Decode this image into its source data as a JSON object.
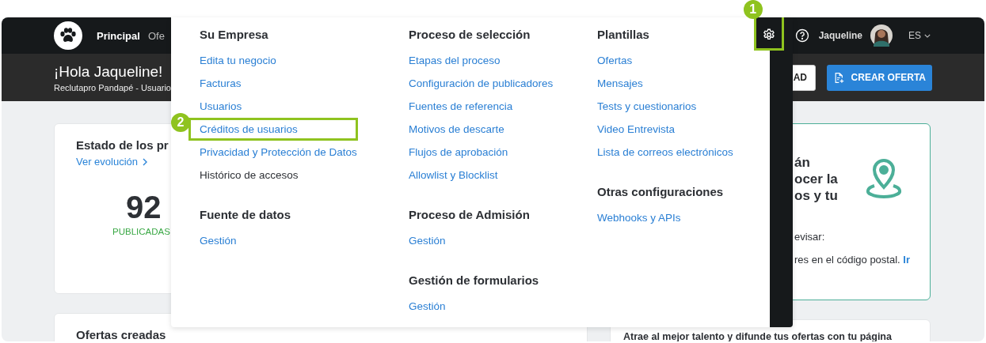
{
  "nav": {
    "items": [
      {
        "label": "Principal",
        "selected": true
      },
      {
        "label": "Ofe",
        "selected": false
      }
    ],
    "settings": {
      "highlighted": true,
      "callout": "1"
    },
    "user": "Jaqueline",
    "language": "ES"
  },
  "header": {
    "greeting": "¡Hola Jaqueline!",
    "subtitle": "Reclutapro Pandapé - Usuario",
    "buttons": [
      {
        "label": "AD",
        "kind": "outline"
      },
      {
        "label": "CREAR OFERTA",
        "kind": "primary"
      }
    ]
  },
  "status_card": {
    "title": "Estado de los pr",
    "link": "Ver evolución",
    "count": "92",
    "count_label": "PUBLICADAS"
  },
  "offers_card": {
    "title": "Ofertas creadas"
  },
  "location_card": {
    "heading_lines": [
      "án",
      "ocer la",
      "os y tu"
    ],
    "review_label": "evisar:",
    "note": "res en el código postal.",
    "note_link": "Ir"
  },
  "talent_card": {
    "text": "Atrae al mejor talento y difunde tus ofertas con tu página"
  },
  "settings_menu": {
    "columns": [
      {
        "sections": [
          {
            "title": "Su Empresa",
            "items": [
              {
                "label": "Edita tu negocio",
                "kind": "link",
                "highlighted": false
              },
              {
                "label": "Facturas",
                "kind": "link",
                "highlighted": false
              },
              {
                "label": "Usuarios",
                "kind": "link",
                "highlighted": false
              },
              {
                "label": "Créditos de usuarios",
                "kind": "link",
                "highlighted": true,
                "callout": "2"
              },
              {
                "label": "Privacidad y Protección de Datos",
                "kind": "link",
                "highlighted": false
              },
              {
                "label": "Histórico de accesos",
                "kind": "plain",
                "highlighted": false
              }
            ]
          },
          {
            "title": "Fuente de datos",
            "items": [
              {
                "label": "Gestión",
                "kind": "link",
                "highlighted": false
              }
            ]
          }
        ]
      },
      {
        "sections": [
          {
            "title": "Proceso de selección",
            "items": [
              {
                "label": "Etapas del proceso",
                "kind": "link",
                "highlighted": false
              },
              {
                "label": "Configuración de publicadores",
                "kind": "link",
                "highlighted": false
              },
              {
                "label": "Fuentes de referencia",
                "kind": "link",
                "highlighted": false
              },
              {
                "label": "Motivos de descarte",
                "kind": "link",
                "highlighted": false
              },
              {
                "label": "Flujos de aprobación",
                "kind": "link",
                "highlighted": false
              },
              {
                "label": "Allowlist y Blocklist",
                "kind": "link",
                "highlighted": false
              }
            ]
          },
          {
            "title": "Proceso de Admisión",
            "items": [
              {
                "label": "Gestión",
                "kind": "link",
                "highlighted": false
              }
            ]
          },
          {
            "title": "Gestión de formularios",
            "items": [
              {
                "label": "Gestión",
                "kind": "link",
                "highlighted": false
              }
            ]
          }
        ]
      },
      {
        "sections": [
          {
            "title": "Plantillas",
            "items": [
              {
                "label": "Ofertas",
                "kind": "link",
                "highlighted": false
              },
              {
                "label": "Mensajes",
                "kind": "link",
                "highlighted": false
              },
              {
                "label": "Tests y cuestionarios",
                "kind": "link",
                "highlighted": false
              },
              {
                "label": "Video Entrevista",
                "kind": "link",
                "highlighted": false
              },
              {
                "label": "Lista de correos electrónicos",
                "kind": "link",
                "highlighted": false
              }
            ]
          },
          {
            "title": "Otras configuraciones",
            "items": [
              {
                "label": "Webhooks y APIs",
                "kind": "link",
                "highlighted": false
              }
            ]
          }
        ]
      }
    ]
  }
}
